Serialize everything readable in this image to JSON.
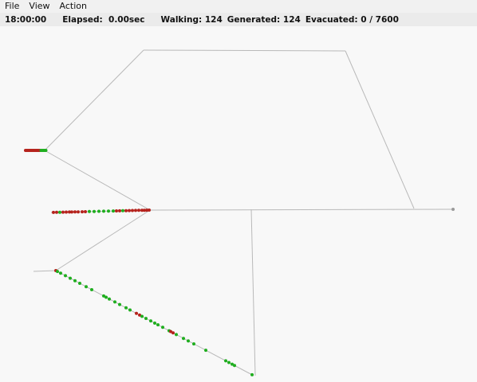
{
  "menu": {
    "items": [
      {
        "label": "File"
      },
      {
        "label": "View"
      },
      {
        "label": "Action"
      }
    ]
  },
  "status": {
    "time": "18:00:00",
    "elapsed_label": "Elapsed:",
    "elapsed_value": "0.00sec",
    "walking_label": "Walking:",
    "walking_value": "124",
    "generated_label": "Generated:",
    "generated_value": "124",
    "evacuated_label": "Evacuated:",
    "evacuated_value": "0 / 7600"
  },
  "colors": {
    "link": "#b9b9b9",
    "node": "#9a9a9a",
    "agent_green": "#1fae1f",
    "agent_red": "#b5221c",
    "background": "#f8f8f8"
  }
}
